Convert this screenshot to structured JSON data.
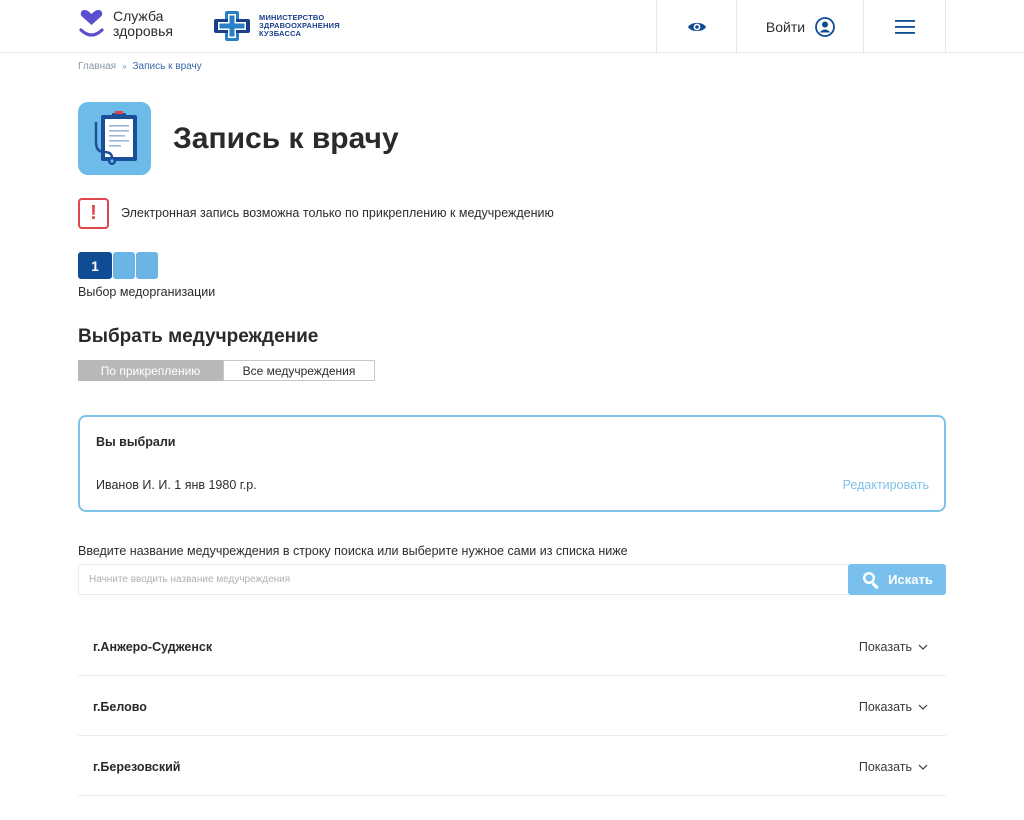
{
  "header": {
    "logo_line1": "Служба",
    "logo_line2": "здоровья",
    "ministry_line1": "МИНИСТЕРСТВО",
    "ministry_line2": "ЗДРАВООХРАНЕНИЯ",
    "ministry_line3": "КУЗБАССА",
    "login_label": "Войти",
    "icons": [
      "heart-logo-icon",
      "medical-cross-logo-icon",
      "eye-icon",
      "user-icon",
      "menu-icon"
    ]
  },
  "breadcrumb": {
    "home": "Главная",
    "separator": "»",
    "current": "Запись к врачу"
  },
  "page": {
    "title": "Запись к врачу",
    "title_icon": "clipboard-stethoscope-icon"
  },
  "notice": {
    "icon": "!",
    "text": "Электронная запись возможна только по прикреплению к медучреждению"
  },
  "steps": {
    "current": "1",
    "total": 3,
    "label": "Выбор медорганизации"
  },
  "section": {
    "title": "Выбрать медучреждение",
    "toggle_active": "По прикреплению",
    "toggle_inactive": "Все медучреждения"
  },
  "selected": {
    "title": "Вы выбрали",
    "person": "Иванов И. И. 1 янв 1980 г.р.",
    "edit": "Редактировать"
  },
  "search": {
    "hint": "Введите название медучреждения в строку поиска или выберите нужное сами из списка ниже",
    "placeholder": "Начните вводить название медучреждения",
    "button": "Искать"
  },
  "cities": [
    {
      "name": "г.Анжеро-Судженск",
      "action": "Показать"
    },
    {
      "name": "г.Белово",
      "action": "Показать"
    },
    {
      "name": "г.Березовский",
      "action": "Показать"
    }
  ],
  "colors": {
    "brand_dark": "#0f4c93",
    "accent_light": "#79c0ec",
    "alert_red": "#e0474c",
    "logo_purple": "#5b4fcf"
  }
}
